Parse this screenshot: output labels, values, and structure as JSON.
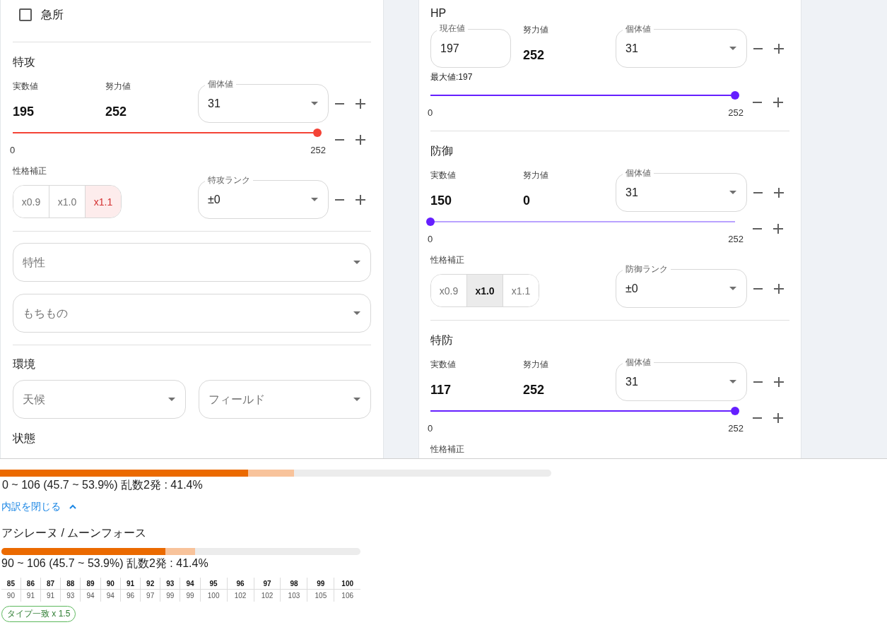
{
  "attacker_panel": {
    "critical_checkbox": {
      "label": "急所",
      "checked": false
    },
    "stat": {
      "title": "特攻",
      "fields": [
        {
          "kind": "readout",
          "label": "実数値",
          "value": "195"
        },
        {
          "kind": "readout",
          "label": "努力値",
          "value": "252"
        }
      ],
      "iv_select": {
        "label": "個体値",
        "value": "31"
      },
      "ev_slider": {
        "level": 1,
        "min_label": "0",
        "max_label": "252"
      },
      "nature": {
        "label": "性格補正",
        "options": [
          {
            "label": "x0.9",
            "kind": "down",
            "selected": false
          },
          {
            "label": "x1.0",
            "kind": "neutral",
            "selected": false
          },
          {
            "label": "x1.1",
            "kind": "up",
            "selected": true
          }
        ]
      },
      "rank_select": {
        "label": "特攻ランク",
        "value": "±0"
      }
    },
    "ability_select": {
      "label": "特性"
    },
    "item_select": {
      "label": "もちもの"
    },
    "environment": {
      "title": "環境",
      "selects": [
        {
          "label": "天候"
        },
        {
          "label": "フィールド"
        }
      ]
    },
    "condition": {
      "title": "状態"
    }
  },
  "defender_panel": {
    "stats": [
      {
        "title": "HP",
        "fields": [
          {
            "kind": "input",
            "label": "現在値",
            "value": "197"
          },
          {
            "kind": "readout",
            "label": "努力値",
            "value": "252"
          }
        ],
        "iv_select": {
          "label": "個体値",
          "value": "31"
        },
        "note": "最大値:197",
        "ev_slider": {
          "level": 1,
          "min_label": "0",
          "max_label": "252"
        }
      },
      {
        "title": "防御",
        "fields": [
          {
            "kind": "readout",
            "label": "実数値",
            "value": "150"
          },
          {
            "kind": "readout",
            "label": "努力値",
            "value": "0"
          }
        ],
        "iv_select": {
          "label": "個体値",
          "value": "31"
        },
        "ev_slider": {
          "level": 0,
          "min_label": "0",
          "max_label": "252"
        },
        "nature": {
          "label": "性格補正",
          "options": [
            {
              "label": "x0.9",
              "kind": "down",
              "selected": false
            },
            {
              "label": "x1.0",
              "kind": "neutral",
              "selected": true
            },
            {
              "label": "x1.1",
              "kind": "up",
              "selected": false
            }
          ]
        },
        "rank_select": {
          "label": "防御ランク",
          "value": "±0"
        }
      },
      {
        "title": "特防",
        "fields": [
          {
            "kind": "readout",
            "label": "実数値",
            "value": "117"
          },
          {
            "kind": "readout",
            "label": "努力値",
            "value": "252"
          }
        ],
        "iv_select": {
          "label": "個体値",
          "value": "31"
        },
        "ev_slider": {
          "level": 1,
          "min_label": "0",
          "max_label": "252"
        },
        "nature": {
          "label": "性格補正"
        }
      }
    ]
  },
  "result_panel": {
    "summary": {
      "damage_bar": [
        {
          "kind": "max",
          "level": 0.539
        },
        {
          "kind": "min",
          "level": 0.457
        }
      ],
      "text": "0 ~ 106 (45.7 ~ 53.9%) 乱数2発 : 41.4%"
    },
    "breakdown_toggle": {
      "label": "内訳を閉じる",
      "expanded": true
    },
    "moves": [
      {
        "title": "アシレーヌ / ムーンフォース",
        "damage_bar": [
          {
            "kind": "max",
            "level": 0.539
          },
          {
            "kind": "min",
            "level": 0.457
          }
        ],
        "text": "90 ~ 106 (45.7 ~ 53.9%) 乱数2発 : 41.4%",
        "roll_table": {
          "header": [
            "85",
            "86",
            "87",
            "88",
            "89",
            "90",
            "91",
            "92",
            "93",
            "94",
            "95",
            "96",
            "97",
            "98",
            "99",
            "100"
          ],
          "rows": [
            [
              "90",
              "91",
              "91",
              "93",
              "94",
              "94",
              "96",
              "97",
              "99",
              "99",
              "100",
              "102",
              "102",
              "103",
              "105",
              "106"
            ]
          ]
        },
        "tags": [
          {
            "label": "タイプ一致 x 1.5"
          }
        ]
      }
    ]
  }
}
